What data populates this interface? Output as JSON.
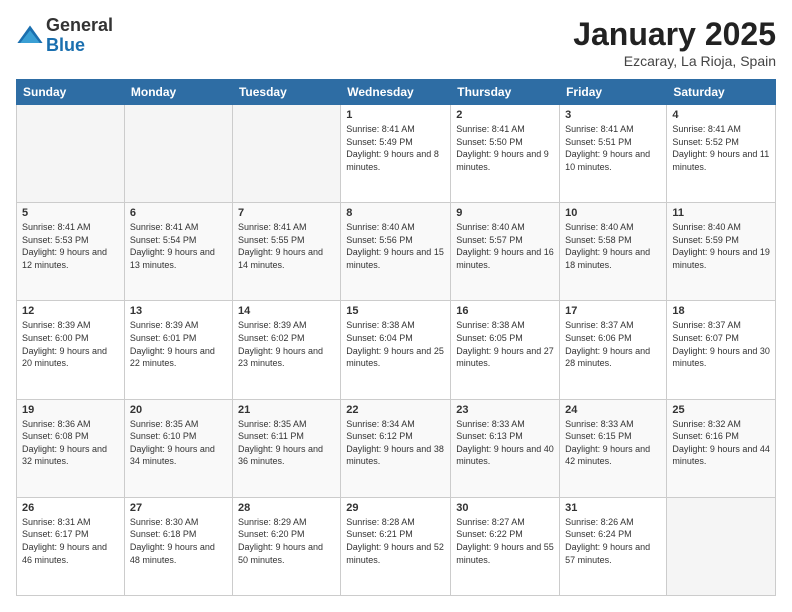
{
  "logo": {
    "general": "General",
    "blue": "Blue"
  },
  "title": "January 2025",
  "location": "Ezcaray, La Rioja, Spain",
  "days_of_week": [
    "Sunday",
    "Monday",
    "Tuesday",
    "Wednesday",
    "Thursday",
    "Friday",
    "Saturday"
  ],
  "weeks": [
    [
      {
        "day": "",
        "info": ""
      },
      {
        "day": "",
        "info": ""
      },
      {
        "day": "",
        "info": ""
      },
      {
        "day": "1",
        "info": "Sunrise: 8:41 AM\nSunset: 5:49 PM\nDaylight: 9 hours\nand 8 minutes."
      },
      {
        "day": "2",
        "info": "Sunrise: 8:41 AM\nSunset: 5:50 PM\nDaylight: 9 hours\nand 9 minutes."
      },
      {
        "day": "3",
        "info": "Sunrise: 8:41 AM\nSunset: 5:51 PM\nDaylight: 9 hours\nand 10 minutes."
      },
      {
        "day": "4",
        "info": "Sunrise: 8:41 AM\nSunset: 5:52 PM\nDaylight: 9 hours\nand 11 minutes."
      }
    ],
    [
      {
        "day": "5",
        "info": "Sunrise: 8:41 AM\nSunset: 5:53 PM\nDaylight: 9 hours\nand 12 minutes."
      },
      {
        "day": "6",
        "info": "Sunrise: 8:41 AM\nSunset: 5:54 PM\nDaylight: 9 hours\nand 13 minutes."
      },
      {
        "day": "7",
        "info": "Sunrise: 8:41 AM\nSunset: 5:55 PM\nDaylight: 9 hours\nand 14 minutes."
      },
      {
        "day": "8",
        "info": "Sunrise: 8:40 AM\nSunset: 5:56 PM\nDaylight: 9 hours\nand 15 minutes."
      },
      {
        "day": "9",
        "info": "Sunrise: 8:40 AM\nSunset: 5:57 PM\nDaylight: 9 hours\nand 16 minutes."
      },
      {
        "day": "10",
        "info": "Sunrise: 8:40 AM\nSunset: 5:58 PM\nDaylight: 9 hours\nand 18 minutes."
      },
      {
        "day": "11",
        "info": "Sunrise: 8:40 AM\nSunset: 5:59 PM\nDaylight: 9 hours\nand 19 minutes."
      }
    ],
    [
      {
        "day": "12",
        "info": "Sunrise: 8:39 AM\nSunset: 6:00 PM\nDaylight: 9 hours\nand 20 minutes."
      },
      {
        "day": "13",
        "info": "Sunrise: 8:39 AM\nSunset: 6:01 PM\nDaylight: 9 hours\nand 22 minutes."
      },
      {
        "day": "14",
        "info": "Sunrise: 8:39 AM\nSunset: 6:02 PM\nDaylight: 9 hours\nand 23 minutes."
      },
      {
        "day": "15",
        "info": "Sunrise: 8:38 AM\nSunset: 6:04 PM\nDaylight: 9 hours\nand 25 minutes."
      },
      {
        "day": "16",
        "info": "Sunrise: 8:38 AM\nSunset: 6:05 PM\nDaylight: 9 hours\nand 27 minutes."
      },
      {
        "day": "17",
        "info": "Sunrise: 8:37 AM\nSunset: 6:06 PM\nDaylight: 9 hours\nand 28 minutes."
      },
      {
        "day": "18",
        "info": "Sunrise: 8:37 AM\nSunset: 6:07 PM\nDaylight: 9 hours\nand 30 minutes."
      }
    ],
    [
      {
        "day": "19",
        "info": "Sunrise: 8:36 AM\nSunset: 6:08 PM\nDaylight: 9 hours\nand 32 minutes."
      },
      {
        "day": "20",
        "info": "Sunrise: 8:35 AM\nSunset: 6:10 PM\nDaylight: 9 hours\nand 34 minutes."
      },
      {
        "day": "21",
        "info": "Sunrise: 8:35 AM\nSunset: 6:11 PM\nDaylight: 9 hours\nand 36 minutes."
      },
      {
        "day": "22",
        "info": "Sunrise: 8:34 AM\nSunset: 6:12 PM\nDaylight: 9 hours\nand 38 minutes."
      },
      {
        "day": "23",
        "info": "Sunrise: 8:33 AM\nSunset: 6:13 PM\nDaylight: 9 hours\nand 40 minutes."
      },
      {
        "day": "24",
        "info": "Sunrise: 8:33 AM\nSunset: 6:15 PM\nDaylight: 9 hours\nand 42 minutes."
      },
      {
        "day": "25",
        "info": "Sunrise: 8:32 AM\nSunset: 6:16 PM\nDaylight: 9 hours\nand 44 minutes."
      }
    ],
    [
      {
        "day": "26",
        "info": "Sunrise: 8:31 AM\nSunset: 6:17 PM\nDaylight: 9 hours\nand 46 minutes."
      },
      {
        "day": "27",
        "info": "Sunrise: 8:30 AM\nSunset: 6:18 PM\nDaylight: 9 hours\nand 48 minutes."
      },
      {
        "day": "28",
        "info": "Sunrise: 8:29 AM\nSunset: 6:20 PM\nDaylight: 9 hours\nand 50 minutes."
      },
      {
        "day": "29",
        "info": "Sunrise: 8:28 AM\nSunset: 6:21 PM\nDaylight: 9 hours\nand 52 minutes."
      },
      {
        "day": "30",
        "info": "Sunrise: 8:27 AM\nSunset: 6:22 PM\nDaylight: 9 hours\nand 55 minutes."
      },
      {
        "day": "31",
        "info": "Sunrise: 8:26 AM\nSunset: 6:24 PM\nDaylight: 9 hours\nand 57 minutes."
      },
      {
        "day": "",
        "info": ""
      }
    ]
  ]
}
